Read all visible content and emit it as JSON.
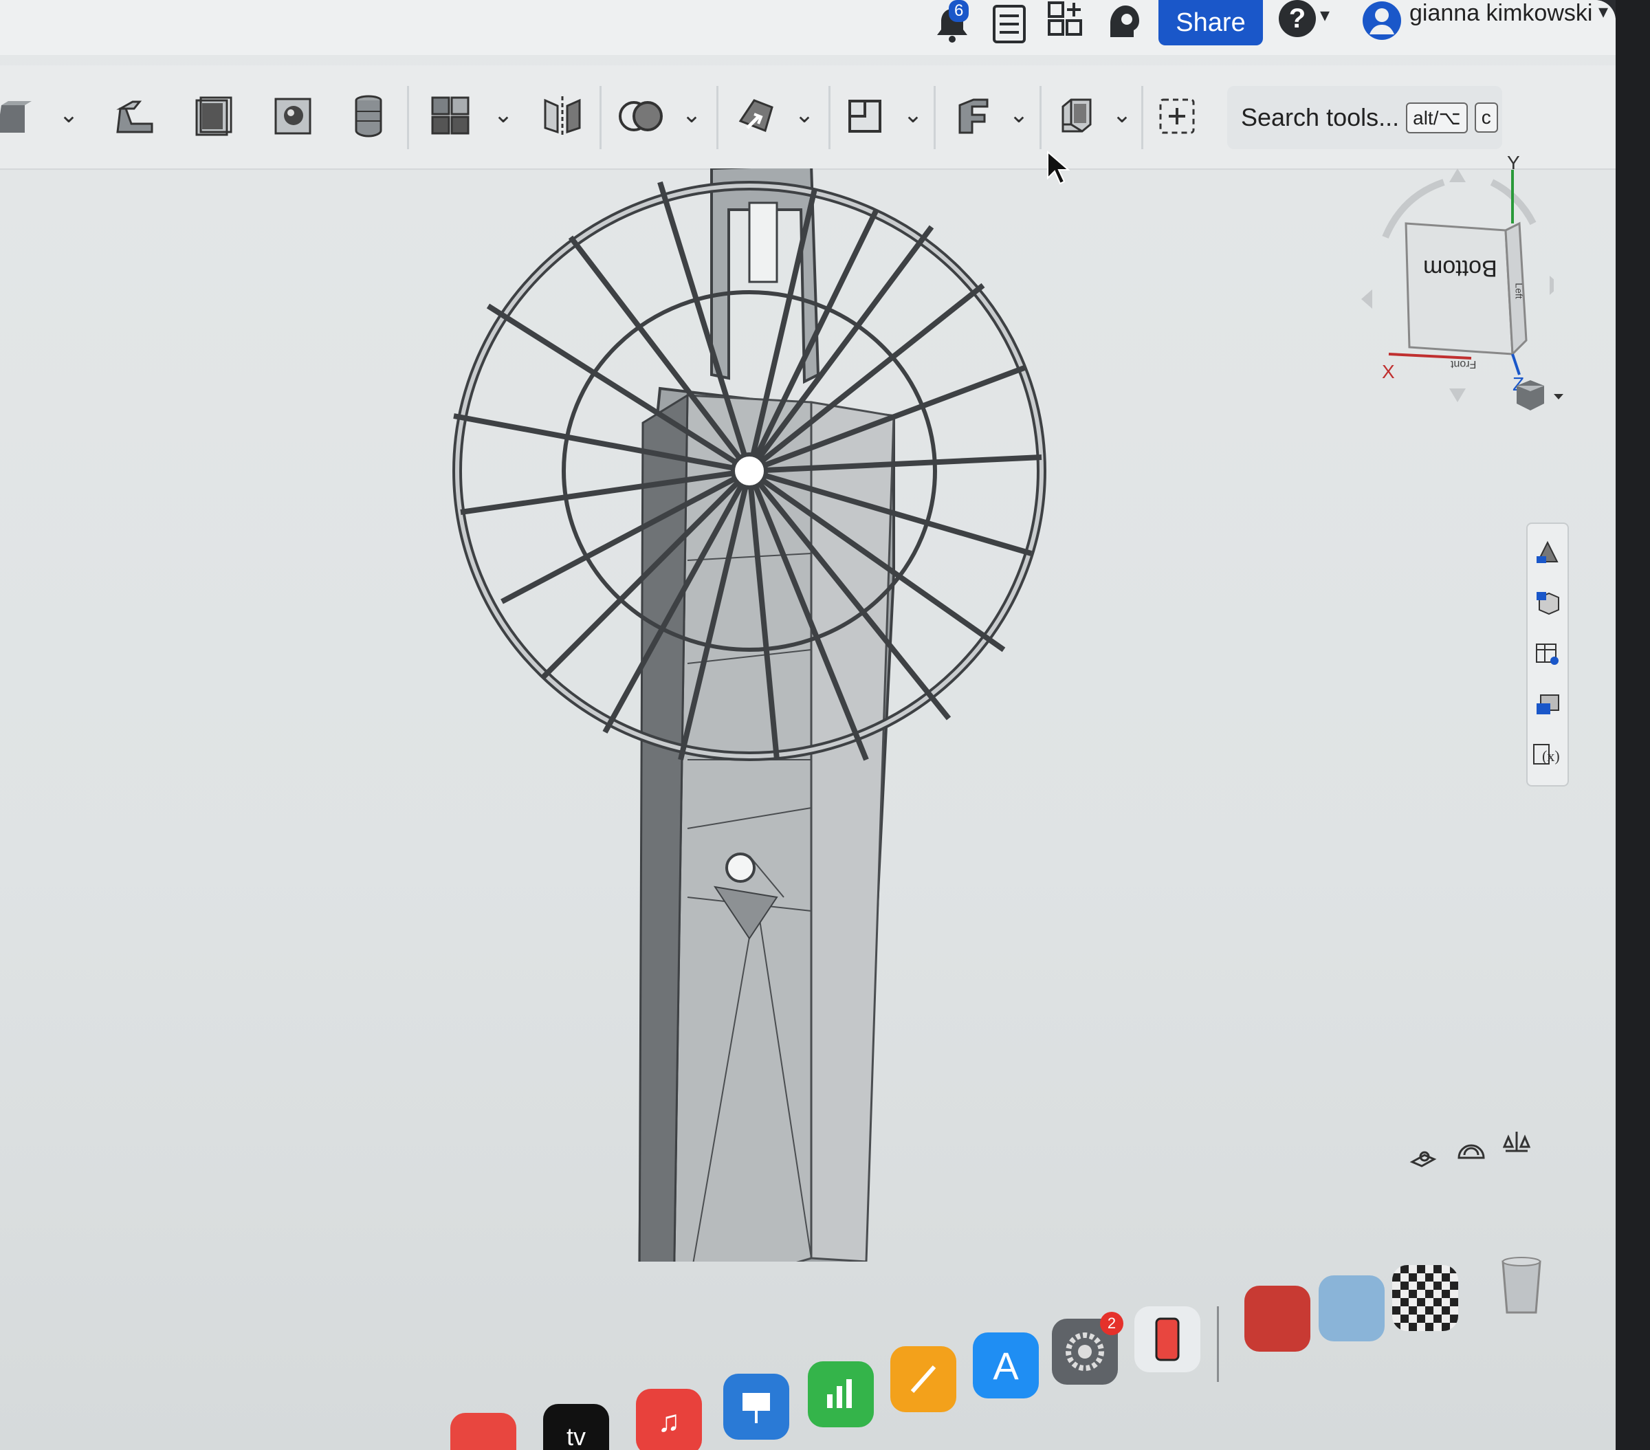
{
  "header": {
    "notification_count": "6",
    "share_label": "Share",
    "help_symbol": "?",
    "user_name": "gianna kimkowski"
  },
  "toolbar": {
    "search_placeholder": "Search tools...",
    "shortcut_modifier": "alt/⌥",
    "shortcut_key": "c",
    "icons": [
      "extrude-icon",
      "sweep-icon",
      "shell-icon",
      "hole-icon",
      "cylinder-icon",
      "pattern-icon",
      "mirror-icon",
      "boolean-icon",
      "transform-icon",
      "plane-icon",
      "sheet-metal-icon",
      "frame-icon",
      "add-feature-icon"
    ]
  },
  "view_cube": {
    "face_label": "Bottom",
    "side_label": "Left",
    "front_label": "Front",
    "axis_x": "X",
    "axis_y": "Y",
    "axis_z": "Z"
  },
  "dock": {
    "app_tv_label": "tv",
    "settings_badge": "2"
  },
  "colors": {
    "accent": "#1a57c9",
    "viewport_bg": "#e1e4e5",
    "model_fill": "#b4b8ba",
    "model_edge": "#4a4d50"
  }
}
